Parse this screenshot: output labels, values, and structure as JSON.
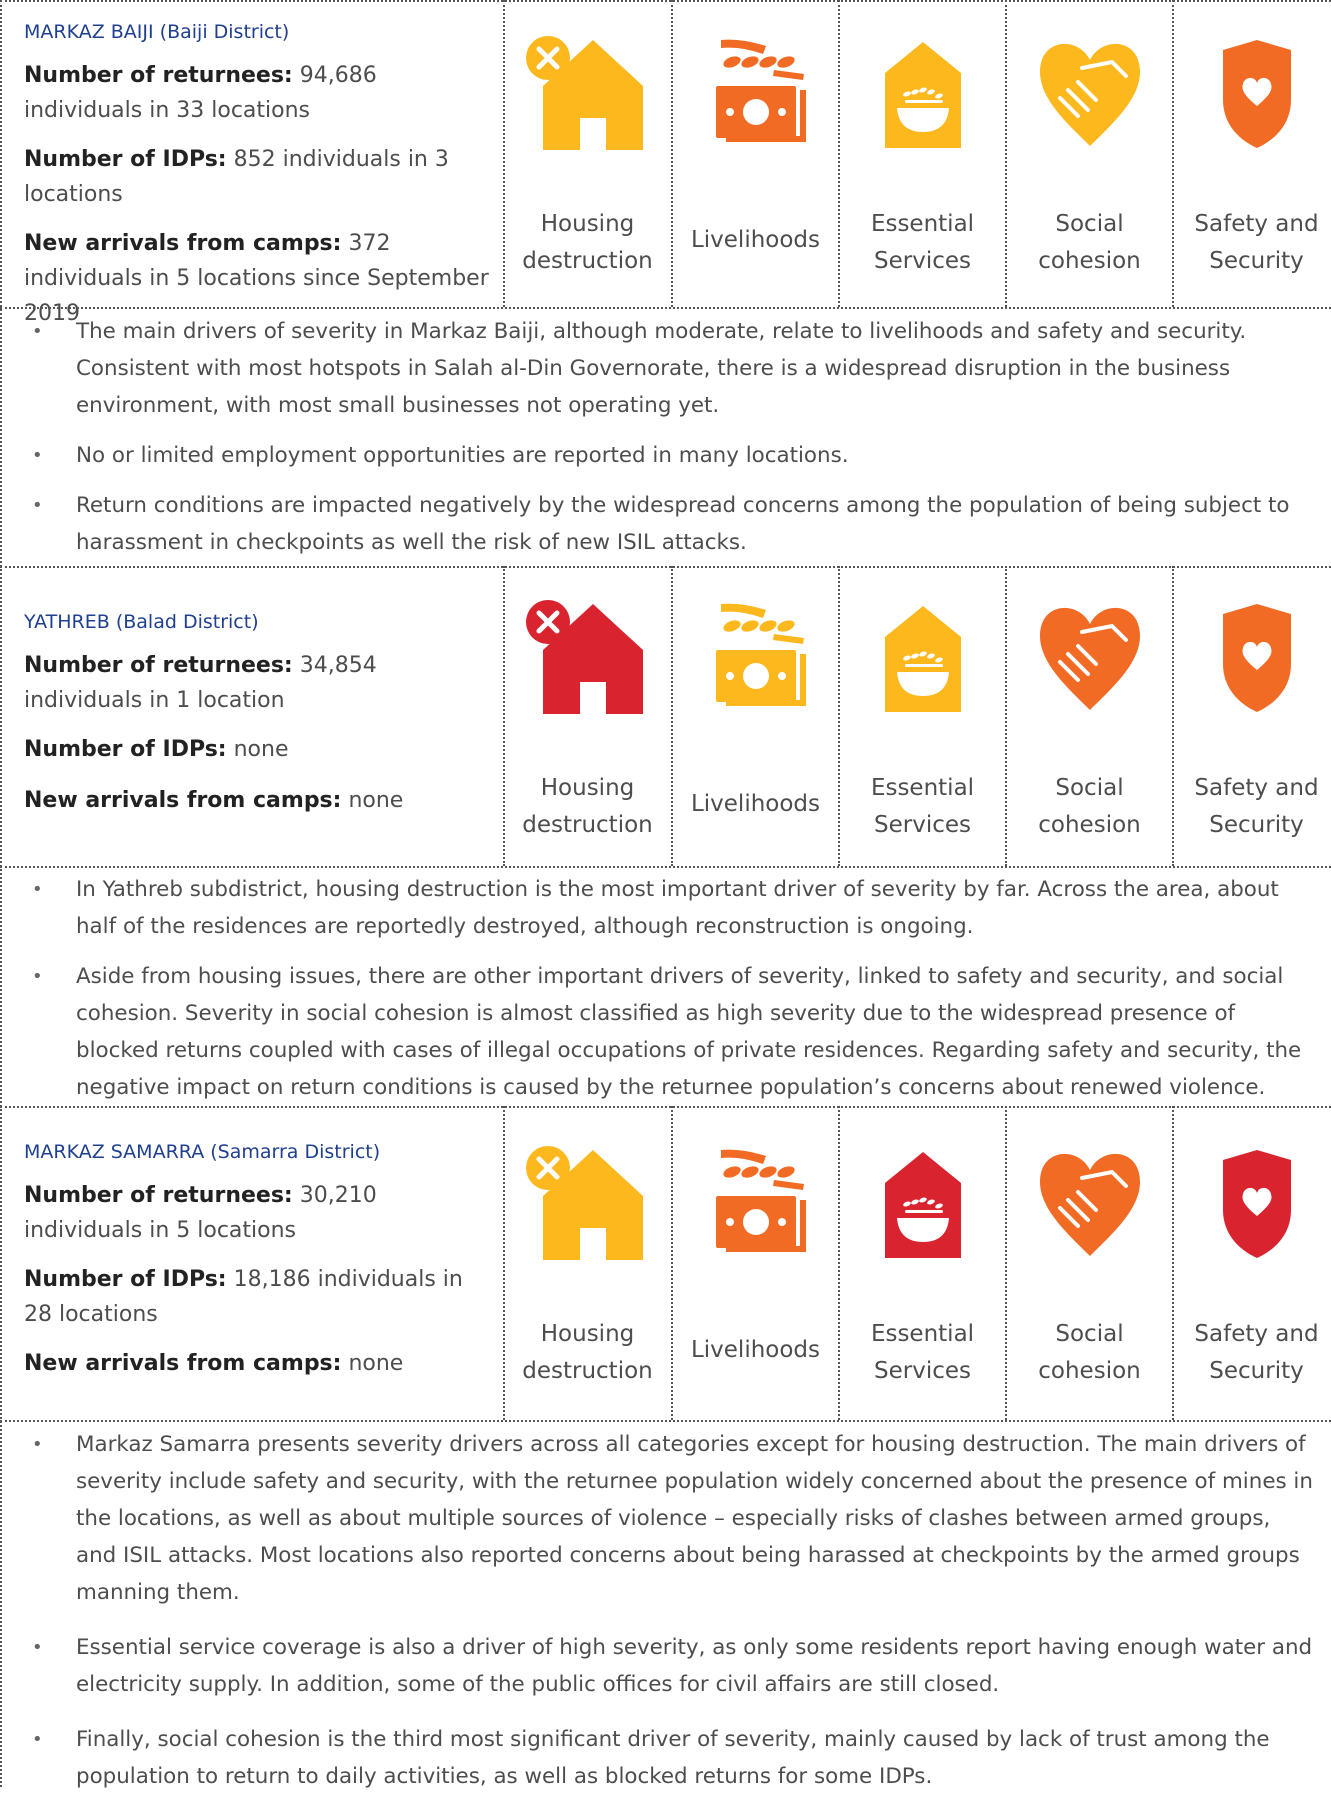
{
  "colors": {
    "red": "#d9232e",
    "orange": "#f26b25",
    "yellow": "#fdb81e",
    "link": "#1f3f8f"
  },
  "icon_labels": {
    "housing": [
      "Housing",
      "destruction"
    ],
    "livelihoods": [
      "Livelihoods"
    ],
    "essential": [
      "Essential",
      "Services"
    ],
    "social": [
      "Social",
      "cohesion"
    ],
    "safety": [
      "Safety and",
      "Security"
    ]
  },
  "sections": [
    {
      "title_name": "MARKAZ BAIJI",
      "title_district": "(Baiji District)",
      "returnees_label": "Number of returnees:",
      "returnees_value": "94,686 individuals in 33 locations",
      "idps_label": "Number of IDPs:",
      "idps_value": "852 individuals in 3 locations",
      "arrivals_label": "New arrivals from camps:",
      "arrivals_value": "372 individuals in 5 locations since September 2019",
      "severity": {
        "housing": "yellow",
        "livelihoods": "orange",
        "essential": "yellow",
        "social": "yellow",
        "safety": "orange"
      },
      "housing_mark": "x-circle-icon",
      "bullets": [
        "The main drivers of severity in Markaz Baiji, although moderate, relate to livelihoods and safety and security. Consistent with most hotspots in Salah al-Din Governorate, there is a widespread disruption in the business environment, with most small businesses not operating yet.",
        "No or limited employment opportunities are reported in many locations.",
        "Return conditions are impacted negatively by the widespread concerns among the population of being subject to harassment in checkpoints as well the risk of new ISIL attacks."
      ]
    },
    {
      "title_name": "YATHREB",
      "title_district": "(Balad District)",
      "returnees_label": "Number of returnees:",
      "returnees_value": "34,854 individuals in 1 location",
      "idps_label": "Number of IDPs:",
      "idps_value": "none",
      "arrivals_label": "New arrivals from camps:",
      "arrivals_value": "none",
      "severity": {
        "housing": "red",
        "livelihoods": "yellow",
        "essential": "yellow",
        "social": "orange",
        "safety": "orange"
      },
      "housing_mark": "x-circle-icon",
      "bullets": [
        "In Yathreb subdistrict, housing destruction is the most important driver of severity by far. Across the area, about half of the residences are reportedly destroyed, although reconstruction is ongoing.",
        "Aside from housing issues, there are other important drivers of severity, linked to safety and security, and social cohesion. Severity in social cohesion is almost classified as high severity due to the widespread presence of blocked returns coupled with cases of illegal occupations of private residences. Regarding safety and security, the negative impact on return conditions is caused by the returnee population’s concerns about renewed violence."
      ]
    },
    {
      "title_name": "MARKAZ SAMARRA",
      "title_district": "(Samarra District)",
      "returnees_label": "Number of returnees:",
      "returnees_value": "30,210 individuals in 5 locations",
      "idps_label": "Number of IDPs:",
      "idps_value": "18,186 individuals in 28 locations",
      "arrivals_label": "New arrivals from camps:",
      "arrivals_value": "none",
      "severity": {
        "housing": "yellow",
        "livelihoods": "orange",
        "essential": "red",
        "social": "orange",
        "safety": "red"
      },
      "housing_mark": "x-circle-icon",
      "bullets": [
        "Markaz Samarra presents severity drivers across all categories except for housing destruction. The main drivers of severity include safety and security, with the returnee population widely concerned about the presence of mines in the locations, as well as about multiple sources of violence – especially risks of clashes between armed groups, and ISIL attacks. Most locations also reported concerns about being harassed at checkpoints by the armed groups manning them.",
        "Essential service coverage is also a driver of high severity, as only some residents report having enough water and electricity supply. In addition, some of the public offices for civil affairs are still closed.",
        "Finally, social cohesion is the third most significant driver of severity, mainly caused by lack of trust among the population to return to daily activities, as well as blocked returns for some IDPs."
      ]
    }
  ]
}
